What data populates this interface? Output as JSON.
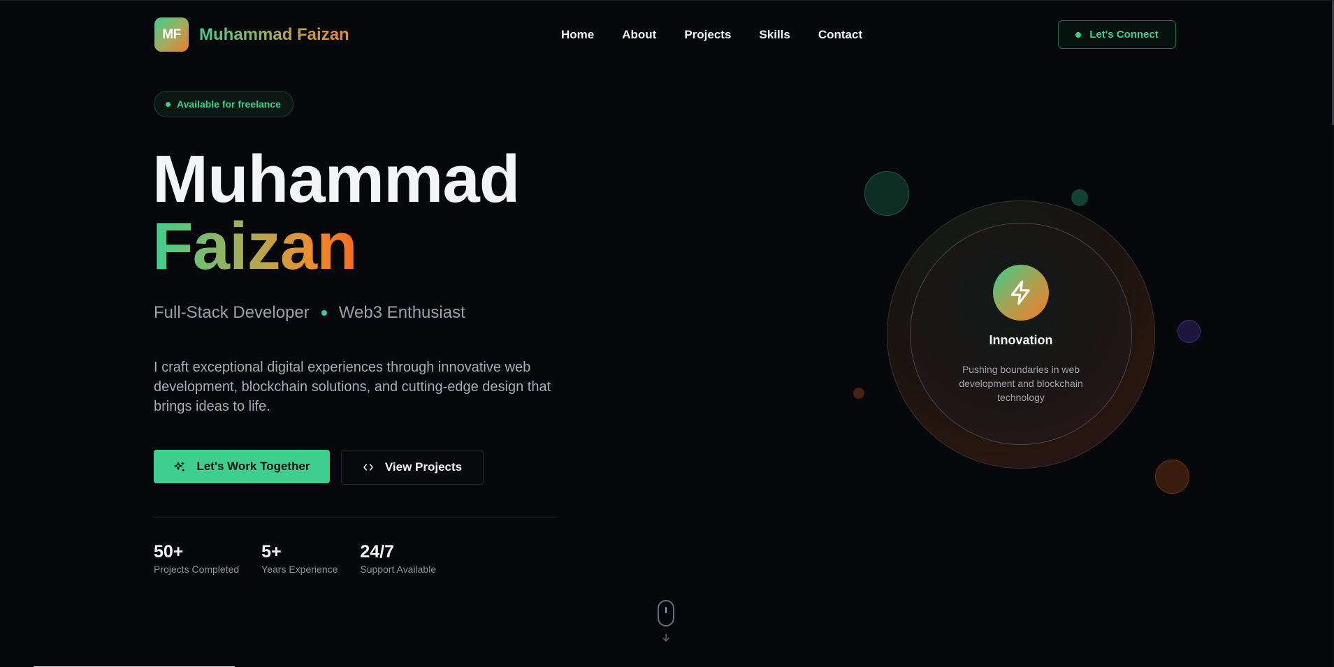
{
  "nav": {
    "logo_initials": "MF",
    "logo_text": "Muhammad Faizan",
    "links": [
      "Home",
      "About",
      "Projects",
      "Skills",
      "Contact"
    ],
    "connect_label": "Let's Connect"
  },
  "hero": {
    "badge": "Available for freelance",
    "first_name": "Muhammad",
    "last_name": "Faizan",
    "role_1": "Full-Stack Developer",
    "role_2": "Web3 Enthusiast",
    "description": "I craft exceptional digital experiences through innovative web development, blockchain solutions, and cutting-edge design that brings ideas to life.",
    "primary_cta": "Let's Work Together",
    "secondary_cta": "View Projects",
    "stats": [
      {
        "value": "50+",
        "label": "Projects Completed"
      },
      {
        "value": "5+",
        "label": "Years Experience"
      },
      {
        "value": "24/7",
        "label": "Support Available"
      }
    ]
  },
  "visual": {
    "title": "Innovation",
    "description": "Pushing boundaries in web development and blockchain technology",
    "icon": "lightning-icon"
  },
  "colors": {
    "accent_green": "#3ecf8e",
    "accent_orange": "#f07a2a",
    "background": "#07080b"
  }
}
